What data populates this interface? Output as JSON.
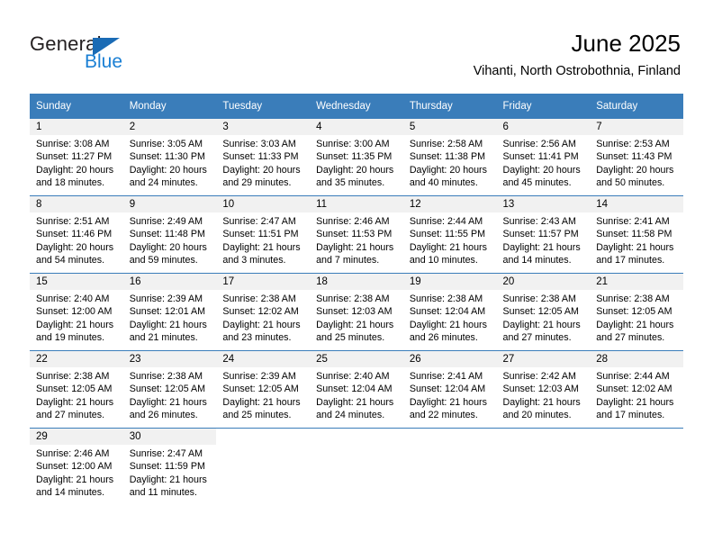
{
  "branding": {
    "name_part1": "General",
    "name_part2": "Blue",
    "triangle_color": "#1a6bb5",
    "blue_color": "#1a7fd4"
  },
  "header": {
    "title": "June 2025",
    "subtitle": "Vihanti, North Ostrobothnia, Finland"
  },
  "theme": {
    "header_bg": "#3a7dba",
    "header_text": "#ffffff",
    "daynum_bg": "#f1f1f1",
    "grid_line": "#3a7dba"
  },
  "calendar": {
    "weekday_headers": [
      "Sunday",
      "Monday",
      "Tuesday",
      "Wednesday",
      "Thursday",
      "Friday",
      "Saturday"
    ],
    "weeks": [
      [
        {
          "day": "1",
          "sunrise": "Sunrise: 3:08 AM",
          "sunset": "Sunset: 11:27 PM",
          "daylight_line1": "Daylight: 20 hours",
          "daylight_line2": "and 18 minutes."
        },
        {
          "day": "2",
          "sunrise": "Sunrise: 3:05 AM",
          "sunset": "Sunset: 11:30 PM",
          "daylight_line1": "Daylight: 20 hours",
          "daylight_line2": "and 24 minutes."
        },
        {
          "day": "3",
          "sunrise": "Sunrise: 3:03 AM",
          "sunset": "Sunset: 11:33 PM",
          "daylight_line1": "Daylight: 20 hours",
          "daylight_line2": "and 29 minutes."
        },
        {
          "day": "4",
          "sunrise": "Sunrise: 3:00 AM",
          "sunset": "Sunset: 11:35 PM",
          "daylight_line1": "Daylight: 20 hours",
          "daylight_line2": "and 35 minutes."
        },
        {
          "day": "5",
          "sunrise": "Sunrise: 2:58 AM",
          "sunset": "Sunset: 11:38 PM",
          "daylight_line1": "Daylight: 20 hours",
          "daylight_line2": "and 40 minutes."
        },
        {
          "day": "6",
          "sunrise": "Sunrise: 2:56 AM",
          "sunset": "Sunset: 11:41 PM",
          "daylight_line1": "Daylight: 20 hours",
          "daylight_line2": "and 45 minutes."
        },
        {
          "day": "7",
          "sunrise": "Sunrise: 2:53 AM",
          "sunset": "Sunset: 11:43 PM",
          "daylight_line1": "Daylight: 20 hours",
          "daylight_line2": "and 50 minutes."
        }
      ],
      [
        {
          "day": "8",
          "sunrise": "Sunrise: 2:51 AM",
          "sunset": "Sunset: 11:46 PM",
          "daylight_line1": "Daylight: 20 hours",
          "daylight_line2": "and 54 minutes."
        },
        {
          "day": "9",
          "sunrise": "Sunrise: 2:49 AM",
          "sunset": "Sunset: 11:48 PM",
          "daylight_line1": "Daylight: 20 hours",
          "daylight_line2": "and 59 minutes."
        },
        {
          "day": "10",
          "sunrise": "Sunrise: 2:47 AM",
          "sunset": "Sunset: 11:51 PM",
          "daylight_line1": "Daylight: 21 hours",
          "daylight_line2": "and 3 minutes."
        },
        {
          "day": "11",
          "sunrise": "Sunrise: 2:46 AM",
          "sunset": "Sunset: 11:53 PM",
          "daylight_line1": "Daylight: 21 hours",
          "daylight_line2": "and 7 minutes."
        },
        {
          "day": "12",
          "sunrise": "Sunrise: 2:44 AM",
          "sunset": "Sunset: 11:55 PM",
          "daylight_line1": "Daylight: 21 hours",
          "daylight_line2": "and 10 minutes."
        },
        {
          "day": "13",
          "sunrise": "Sunrise: 2:43 AM",
          "sunset": "Sunset: 11:57 PM",
          "daylight_line1": "Daylight: 21 hours",
          "daylight_line2": "and 14 minutes."
        },
        {
          "day": "14",
          "sunrise": "Sunrise: 2:41 AM",
          "sunset": "Sunset: 11:58 PM",
          "daylight_line1": "Daylight: 21 hours",
          "daylight_line2": "and 17 minutes."
        }
      ],
      [
        {
          "day": "15",
          "sunrise": "Sunrise: 2:40 AM",
          "sunset": "Sunset: 12:00 AM",
          "daylight_line1": "Daylight: 21 hours",
          "daylight_line2": "and 19 minutes."
        },
        {
          "day": "16",
          "sunrise": "Sunrise: 2:39 AM",
          "sunset": "Sunset: 12:01 AM",
          "daylight_line1": "Daylight: 21 hours",
          "daylight_line2": "and 21 minutes."
        },
        {
          "day": "17",
          "sunrise": "Sunrise: 2:38 AM",
          "sunset": "Sunset: 12:02 AM",
          "daylight_line1": "Daylight: 21 hours",
          "daylight_line2": "and 23 minutes."
        },
        {
          "day": "18",
          "sunrise": "Sunrise: 2:38 AM",
          "sunset": "Sunset: 12:03 AM",
          "daylight_line1": "Daylight: 21 hours",
          "daylight_line2": "and 25 minutes."
        },
        {
          "day": "19",
          "sunrise": "Sunrise: 2:38 AM",
          "sunset": "Sunset: 12:04 AM",
          "daylight_line1": "Daylight: 21 hours",
          "daylight_line2": "and 26 minutes."
        },
        {
          "day": "20",
          "sunrise": "Sunrise: 2:38 AM",
          "sunset": "Sunset: 12:05 AM",
          "daylight_line1": "Daylight: 21 hours",
          "daylight_line2": "and 27 minutes."
        },
        {
          "day": "21",
          "sunrise": "Sunrise: 2:38 AM",
          "sunset": "Sunset: 12:05 AM",
          "daylight_line1": "Daylight: 21 hours",
          "daylight_line2": "and 27 minutes."
        }
      ],
      [
        {
          "day": "22",
          "sunrise": "Sunrise: 2:38 AM",
          "sunset": "Sunset: 12:05 AM",
          "daylight_line1": "Daylight: 21 hours",
          "daylight_line2": "and 27 minutes."
        },
        {
          "day": "23",
          "sunrise": "Sunrise: 2:38 AM",
          "sunset": "Sunset: 12:05 AM",
          "daylight_line1": "Daylight: 21 hours",
          "daylight_line2": "and 26 minutes."
        },
        {
          "day": "24",
          "sunrise": "Sunrise: 2:39 AM",
          "sunset": "Sunset: 12:05 AM",
          "daylight_line1": "Daylight: 21 hours",
          "daylight_line2": "and 25 minutes."
        },
        {
          "day": "25",
          "sunrise": "Sunrise: 2:40 AM",
          "sunset": "Sunset: 12:04 AM",
          "daylight_line1": "Daylight: 21 hours",
          "daylight_line2": "and 24 minutes."
        },
        {
          "day": "26",
          "sunrise": "Sunrise: 2:41 AM",
          "sunset": "Sunset: 12:04 AM",
          "daylight_line1": "Daylight: 21 hours",
          "daylight_line2": "and 22 minutes."
        },
        {
          "day": "27",
          "sunrise": "Sunrise: 2:42 AM",
          "sunset": "Sunset: 12:03 AM",
          "daylight_line1": "Daylight: 21 hours",
          "daylight_line2": "and 20 minutes."
        },
        {
          "day": "28",
          "sunrise": "Sunrise: 2:44 AM",
          "sunset": "Sunset: 12:02 AM",
          "daylight_line1": "Daylight: 21 hours",
          "daylight_line2": "and 17 minutes."
        }
      ],
      [
        {
          "day": "29",
          "sunrise": "Sunrise: 2:46 AM",
          "sunset": "Sunset: 12:00 AM",
          "daylight_line1": "Daylight: 21 hours",
          "daylight_line2": "and 14 minutes."
        },
        {
          "day": "30",
          "sunrise": "Sunrise: 2:47 AM",
          "sunset": "Sunset: 11:59 PM",
          "daylight_line1": "Daylight: 21 hours",
          "daylight_line2": "and 11 minutes."
        },
        {
          "day": "",
          "sunrise": "",
          "sunset": "",
          "daylight_line1": "",
          "daylight_line2": ""
        },
        {
          "day": "",
          "sunrise": "",
          "sunset": "",
          "daylight_line1": "",
          "daylight_line2": ""
        },
        {
          "day": "",
          "sunrise": "",
          "sunset": "",
          "daylight_line1": "",
          "daylight_line2": ""
        },
        {
          "day": "",
          "sunrise": "",
          "sunset": "",
          "daylight_line1": "",
          "daylight_line2": ""
        },
        {
          "day": "",
          "sunrise": "",
          "sunset": "",
          "daylight_line1": "",
          "daylight_line2": ""
        }
      ]
    ]
  }
}
